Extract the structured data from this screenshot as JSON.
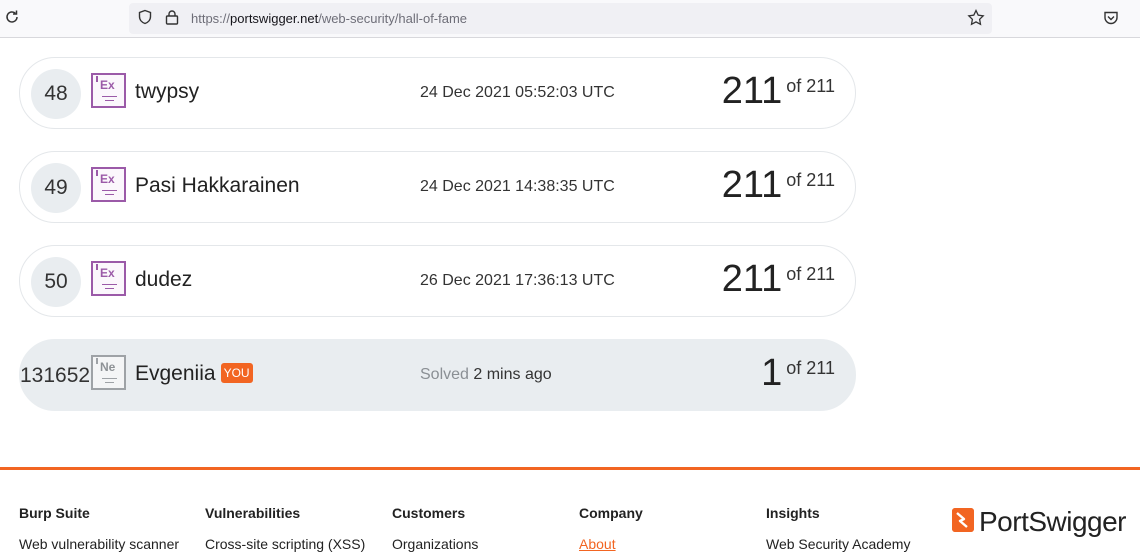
{
  "browser": {
    "url_prefix": "https://",
    "url_domain": "portswigger.net",
    "url_path": "/web-security/hall-of-fame",
    "icons": [
      "reload-icon",
      "shield-icon",
      "lock-icon",
      "star-icon",
      "pocket-icon"
    ]
  },
  "leaderboard": {
    "rows": [
      {
        "rank": "48",
        "badge": "Ex",
        "name": "twypsy",
        "date": "24 Dec 2021 05:52:03 UTC",
        "score": "211",
        "of": "of 211"
      },
      {
        "rank": "49",
        "badge": "Ex",
        "name": "Pasi Hakkarainen",
        "date": "24 Dec 2021 14:38:35 UTC",
        "score": "211",
        "of": "of 211"
      },
      {
        "rank": "50",
        "badge": "Ex",
        "name": "dudez",
        "date": "26 Dec 2021 17:36:13 UTC",
        "score": "211",
        "of": "of 211"
      }
    ],
    "me": {
      "rank": "131652",
      "badge": "Ne",
      "name": "Evgeniia",
      "you_label": "YOU",
      "solved_prefix": "Solved",
      "solved_time": "2 mins ago",
      "score": "1",
      "of": "of 211"
    }
  },
  "footer": {
    "columns": [
      {
        "heading": "Burp Suite",
        "link": "Web vulnerability scanner"
      },
      {
        "heading": "Vulnerabilities",
        "link": "Cross-site scripting (XSS)"
      },
      {
        "heading": "Customers",
        "link": "Organizations"
      },
      {
        "heading": "Company",
        "link": "About"
      },
      {
        "heading": "Insights",
        "link": "Web Security Academy"
      }
    ],
    "logo_text": "PortSwigger"
  },
  "colors": {
    "accent": "#f26522",
    "expert_badge": "#9b5aa8",
    "row_highlight": "#e9edf0"
  }
}
